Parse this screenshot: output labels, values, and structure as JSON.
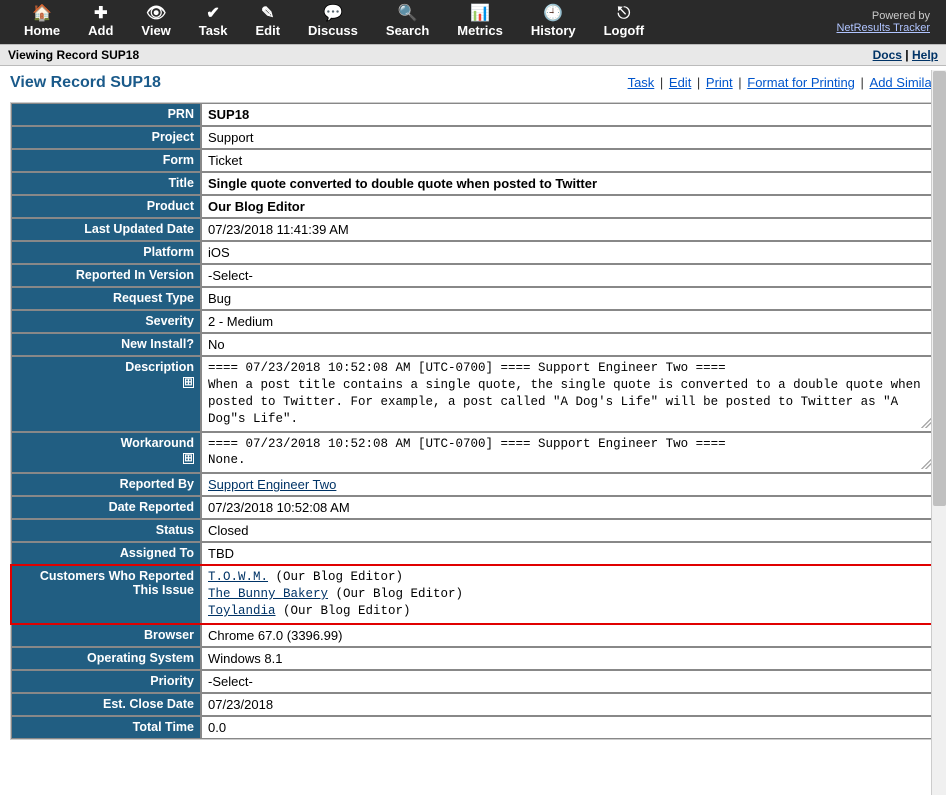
{
  "toolbar": {
    "items": [
      {
        "icon": "home-icon",
        "glyph": "🏠",
        "label": "Home"
      },
      {
        "icon": "add-icon",
        "glyph": "✚",
        "label": "Add"
      },
      {
        "icon": "view-icon",
        "glyph": "👁",
        "label": "View"
      },
      {
        "icon": "task-icon",
        "glyph": "✔",
        "label": "Task"
      },
      {
        "icon": "edit-icon",
        "glyph": "✎",
        "label": "Edit"
      },
      {
        "icon": "discuss-icon",
        "glyph": "💬",
        "label": "Discuss"
      },
      {
        "icon": "search-icon",
        "glyph": "🔍",
        "label": "Search"
      },
      {
        "icon": "metrics-icon",
        "glyph": "📊",
        "label": "Metrics"
      },
      {
        "icon": "history-icon",
        "glyph": "🕘",
        "label": "History"
      },
      {
        "icon": "logoff-icon",
        "glyph": "⎋",
        "label": "Logoff"
      }
    ],
    "powered_by": "Powered by",
    "powered_link": "NetResults Tracker"
  },
  "subbar": {
    "left": "Viewing Record SUP18",
    "docs": "Docs",
    "help": "Help"
  },
  "page": {
    "title": "View Record SUP18",
    "actions": [
      "Task",
      "Edit",
      "Print",
      "Format for Printing",
      "Add Similar"
    ]
  },
  "record": {
    "rows": [
      {
        "label": "PRN",
        "value": "SUP18",
        "bold": true
      },
      {
        "label": "Project",
        "value": "Support"
      },
      {
        "label": "Form",
        "value": "Ticket"
      },
      {
        "label": "Title",
        "value": "Single quote converted to double quote when posted to Twitter",
        "bold": true
      },
      {
        "label": "Product",
        "value": "Our Blog Editor",
        "bold": true
      },
      {
        "label": "Last Updated Date",
        "value": "07/23/2018 11:41:39 AM"
      },
      {
        "label": "Platform",
        "value": "iOS"
      },
      {
        "label": "Reported In Version",
        "value": "-Select-"
      },
      {
        "label": "Request Type",
        "value": "Bug"
      },
      {
        "label": "Severity",
        "value": "2 - Medium"
      },
      {
        "label": "New Install?",
        "value": "No"
      }
    ],
    "description_label": "Description",
    "description": "==== 07/23/2018 10:52:08 AM [UTC-0700] ==== Support Engineer Two ====\nWhen a post title contains a single quote, the single quote is converted to a double quote when posted to Twitter. For example, a post called \"A Dog's Life\" will be posted to Twitter as \"A Dog\"s Life\".",
    "workaround_label": "Workaround",
    "workaround": "==== 07/23/2018 10:52:08 AM [UTC-0700] ==== Support Engineer Two ====\nNone.",
    "rows2": [
      {
        "label": "Reported By",
        "value": "Support Engineer Two",
        "link": true
      },
      {
        "label": "Date Reported",
        "value": "07/23/2018 10:52:08 AM"
      },
      {
        "label": "Status",
        "value": "Closed"
      },
      {
        "label": "Assigned To",
        "value": "TBD"
      }
    ],
    "customers_label": "Customers Who Reported This Issue",
    "customers": [
      {
        "name": "T.O.W.M.",
        "product": "(Our Blog Editor)"
      },
      {
        "name": "The Bunny Bakery",
        "product": "(Our Blog Editor)"
      },
      {
        "name": "Toylandia",
        "product": "(Our Blog Editor)"
      }
    ],
    "rows3": [
      {
        "label": "Browser",
        "value": "Chrome 67.0 (3396.99)"
      },
      {
        "label": "Operating System",
        "value": "Windows 8.1"
      },
      {
        "label": "Priority",
        "value": "-Select-"
      },
      {
        "label": "Est. Close Date",
        "value": "07/23/2018"
      },
      {
        "label": "Total Time",
        "value": "0.0"
      }
    ]
  }
}
